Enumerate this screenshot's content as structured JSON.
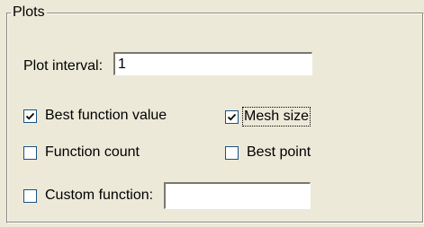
{
  "group": {
    "title": "Plots"
  },
  "plot_interval": {
    "label": "Plot interval:",
    "value": "1"
  },
  "options": {
    "best_function_value": {
      "label": "Best function value",
      "checked": true
    },
    "mesh_size": {
      "label": "Mesh size",
      "checked": true
    },
    "function_count": {
      "label": "Function count",
      "checked": false
    },
    "best_point": {
      "label": "Best point",
      "checked": false
    },
    "custom_function": {
      "label": "Custom function:",
      "checked": false,
      "value": ""
    }
  },
  "icons": {
    "check": "check-mark-icon"
  },
  "colors": {
    "panel_bg": "#ece9d8",
    "checkbox_border": "#1c5180",
    "check_mark": "#21a121"
  }
}
